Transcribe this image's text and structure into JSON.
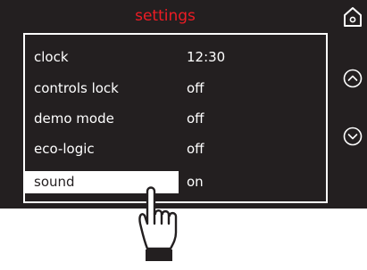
{
  "header": {
    "title": "settings"
  },
  "settings_list": {
    "items": [
      {
        "label": "clock",
        "value": "12:30",
        "selected": false
      },
      {
        "label": "controls lock",
        "value": "off",
        "selected": false
      },
      {
        "label": "demo mode",
        "value": "off",
        "selected": false
      },
      {
        "label": "eco-logic",
        "value": "off",
        "selected": false
      },
      {
        "label": "sound",
        "value": "on",
        "selected": true
      }
    ]
  },
  "icons": {
    "home": "home-icon",
    "scroll_up": "chevron-up-circle-icon",
    "scroll_down": "chevron-down-circle-icon",
    "pointer": "pointing-hand-icon"
  },
  "colors": {
    "screen_background": "#231f20",
    "title": "#ed1c24",
    "text": "#ffffff",
    "selection": "#ffffff"
  }
}
